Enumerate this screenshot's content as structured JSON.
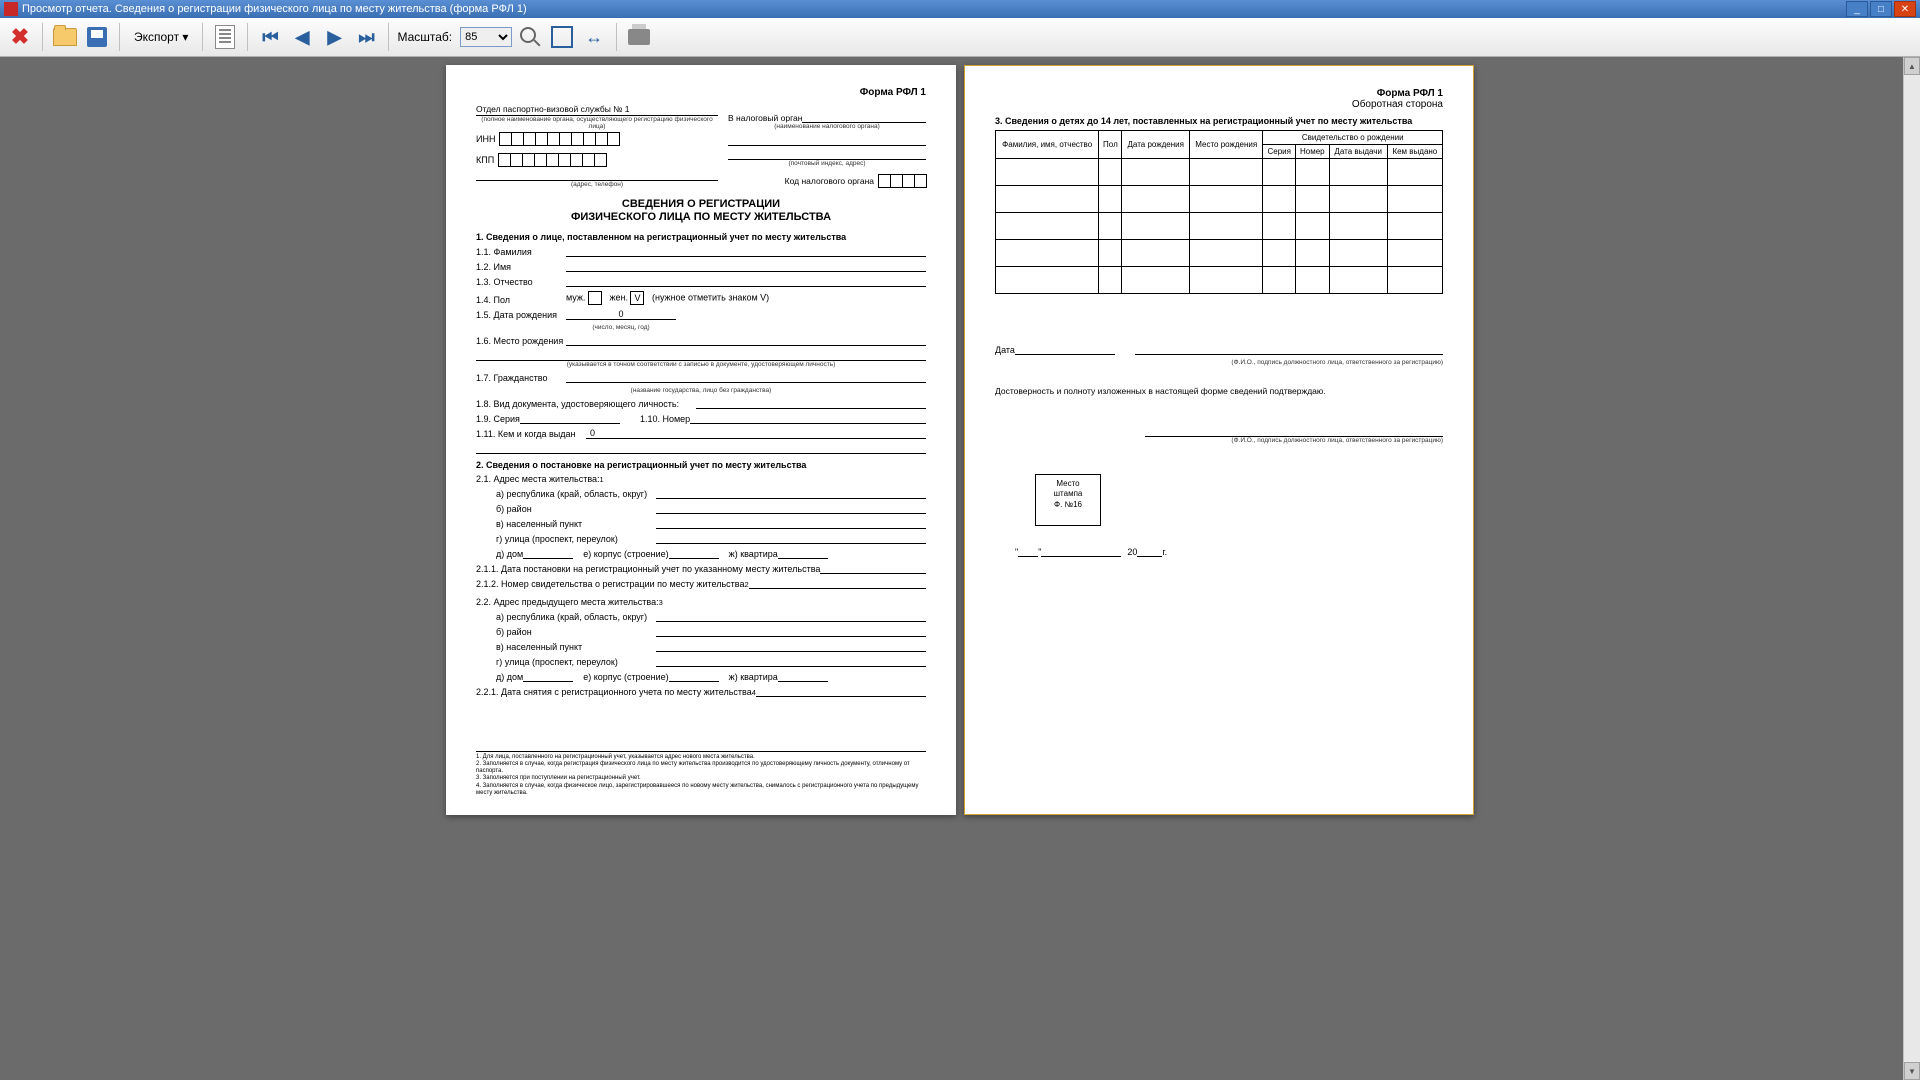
{
  "window": {
    "title": "Просмотр отчета. Сведения о регистрации физического лица по месту жительства (форма РФЛ 1)"
  },
  "toolbar": {
    "export": "Экспорт ▾",
    "zoom_label": "Масштаб:",
    "zoom_value": "85"
  },
  "p1": {
    "form": "Форма РФЛ 1",
    "dept": "Отдел паспортно-визовой службы  № 1",
    "dept_hint": "(полное наименование органа, осуществляющего регистрацию физического лица)",
    "to_tax": "В налоговый орган",
    "to_tax_hint": "(наименование налогового органа)",
    "inn": "ИНН",
    "kpp": "КПП",
    "addr_hint": "(адрес, телефон)",
    "post_hint": "(почтовый индекс, адрес)",
    "tax_code": "Код налогового органа",
    "title1": "СВЕДЕНИЯ О РЕГИСТРАЦИИ",
    "title2": "ФИЗИЧЕСКОГО ЛИЦА ПО МЕСТУ ЖИТЕЛЬСТВА",
    "s1": "1. Сведения о лице, поставленном на регистрационный учет по месту жительства",
    "f11": "1.1. Фамилия",
    "f12": "1.2. Имя",
    "f13": "1.3. Отчество",
    "f14": "1.4. Пол",
    "male": "муж.",
    "female": "жен.",
    "mark": "V",
    "mark_hint": "(нужное отметить знаком V)",
    "f15": "1.5. Дата рождения",
    "dob": "0",
    "dob_hint": "(число, месяц, год)",
    "f16": "1.6. Место рождения",
    "f16_hint": "(указывается в точном соответствии с записью в документе, удостоверяющем личность)",
    "f17": "1.7. Гражданство",
    "f17_hint": "(название государства, лицо без гражданства)",
    "f18": "1.8. Вид документа, удостоверяющего личность:",
    "f19": "1.9. Серия",
    "f110": "1.10. Номер",
    "f111": "1.11. Кем и когда выдан",
    "f111v": "0",
    "s2": "2. Сведения о постановке на регистрационный учет по месту жительства",
    "f21": "2.1. Адрес места жительства:",
    "sup1": "1",
    "a": "а) республика (край, область, округ)",
    "b": "б) район",
    "c": "в) населенный пункт",
    "d": "г) улица (проспект, переулок)",
    "e1": "д) дом",
    "e2": "е) корпус (строение)",
    "e3": "ж) квартира",
    "f211": "2.1.1. Дата постановки на регистрационный учет по указанному месту жительства",
    "f212": "2.1.2. Номер свидетельства о регистрации по месту жительства",
    "sup2": "2",
    "f22": "2.2. Адрес предыдущего места жительства:",
    "sup3": "3",
    "f221": "2.2.1. Дата снятия с регистрационного учета по месту жительства",
    "sup4": "4",
    "fn1": "1. Для лица, поставленного на регистрационный учет, указывается адрес нового места жительства.",
    "fn2": "2. Заполняется в случае, когда регистрация физического лица по месту жительства производится по удостоверяющему личность документу, отличному от паспорта.",
    "fn3": "3. Заполняется при поступлении на регистрационный учет.",
    "fn4": "4. Заполняется в случае, когда физическое лицо, зарегистрировавшееся по новому месту жительства, снималось с регистрационного учета по предыдущему месту жительства."
  },
  "p2": {
    "form": "Форма РФЛ 1",
    "side": "Оборотная сторона",
    "s3": "3. Сведения о детях до 14 лет, поставленных на регистрационный учет по месту жительства",
    "th_fio": "Фамилия, имя, отчество",
    "th_sex": "Пол",
    "th_dob": "Дата рождения",
    "th_pob": "Место рождения",
    "th_cert": "Свидетельство о рождении",
    "th_ser": "Серия",
    "th_num": "Номер",
    "th_date": "Дата выдачи",
    "th_by": "Кем выдано",
    "date": "Дата",
    "sig_hint": "(Ф.И.О., подпись должностного лица, ответственного за регистрацию)",
    "conf": "Достоверность и полноту изложенных в настоящей форме сведений подтверждаю.",
    "sig2_hint": "(Ф.И.О., подпись должностного лица, ответственного за регистрацию)",
    "stamp1": "Место",
    "stamp2": "штампа",
    "stamp3": "Ф. №16",
    "q1": "\"",
    "q2": "\"",
    "y20": "20",
    "yg": "г."
  }
}
